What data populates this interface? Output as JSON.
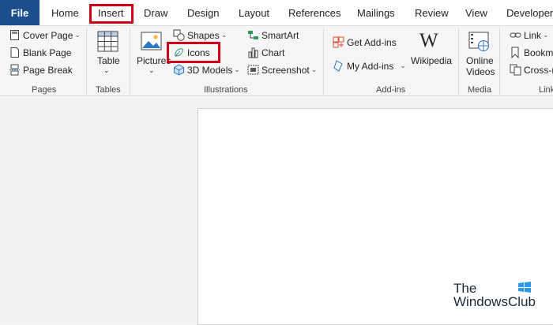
{
  "tabs": [
    "File",
    "Home",
    "Insert",
    "Draw",
    "Design",
    "Layout",
    "References",
    "Mailings",
    "Review",
    "View",
    "Developer"
  ],
  "pages_group": {
    "cover_page": "Cover Page",
    "blank_page": "Blank Page",
    "page_break": "Page Break",
    "label": "Pages"
  },
  "tables_group": {
    "table": "Table",
    "label": "Tables"
  },
  "illustrations_group": {
    "pictures": "Pictures",
    "shapes": "Shapes",
    "icons": "Icons",
    "models_3d": "3D Models",
    "smartart": "SmartArt",
    "chart": "Chart",
    "screenshot": "Screenshot",
    "label": "Illustrations"
  },
  "addins_group": {
    "get_addins": "Get Add-ins",
    "my_addins": "My Add-ins",
    "wikipedia": "Wikipedia",
    "label": "Add-ins"
  },
  "media_group": {
    "online_videos_line1": "Online",
    "online_videos_line2": "Videos",
    "label": "Media"
  },
  "links_group": {
    "link": "Link",
    "bookmark": "Bookma",
    "cross_ref": "Cross-re",
    "label": "Link"
  },
  "watermark": {
    "line1": "The",
    "line2": "WindowsClub"
  },
  "colors": {
    "file_tab": "#1c4e8e",
    "highlight": "#d0021b",
    "flag": "#2f9be6"
  }
}
